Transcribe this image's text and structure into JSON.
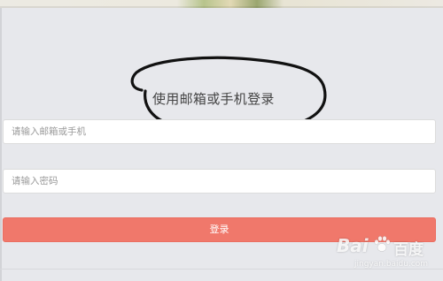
{
  "form": {
    "heading": "使用邮箱或手机登录",
    "email_placeholder": "请输入邮箱或手机",
    "email_value": "",
    "password_placeholder": "请输入密码",
    "password_value": "",
    "login_label": "登录"
  },
  "colors": {
    "page_bg": "#e7e8ec",
    "login_button": "#f0786b",
    "annotation_stroke": "#111111"
  },
  "watermark": {
    "brand": "Bai",
    "brand_suffix": "百度",
    "caption": "jingyan.baidu.com"
  }
}
